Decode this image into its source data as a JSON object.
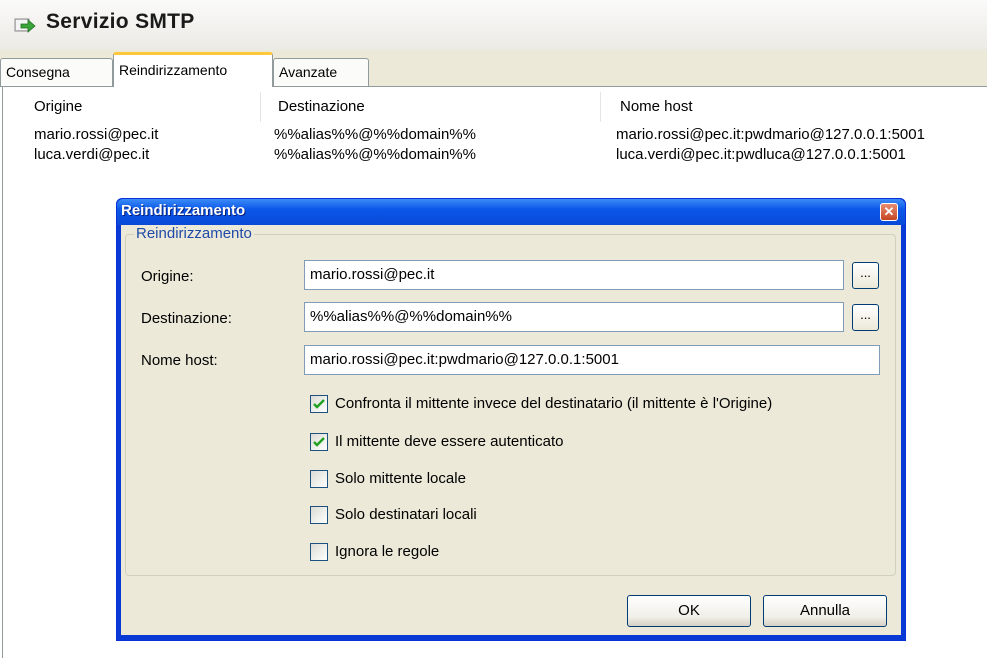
{
  "header": {
    "title": "Servizio SMTP",
    "icon": "arrow-icon"
  },
  "tabs": [
    {
      "label": "Consegna"
    },
    {
      "label": "Reindirizzamento",
      "active": true
    },
    {
      "label": "Avanzate"
    }
  ],
  "list": {
    "columns": [
      "Origine",
      "Destinazione",
      "Nome host"
    ],
    "rows": [
      {
        "origine": "mario.rossi@pec.it",
        "destinazione": "%%alias%%@%%domain%%",
        "host": "mario.rossi@pec.it:pwdmario@127.0.0.1:5001"
      },
      {
        "origine": "luca.verdi@pec.it",
        "destinazione": "%%alias%%@%%domain%%",
        "host": "luca.verdi@pec.it:pwdluca@127.0.0.1:5001"
      }
    ]
  },
  "dialog": {
    "title": "Reindirizzamento",
    "close_glyph": "✕",
    "group_label": "Reindirizzamento",
    "fields": {
      "origine_label": "Origine:",
      "origine_value": "mario.rossi@pec.it",
      "destinazione_label": "Destinazione:",
      "destinazione_value": "%%alias%%@%%domain%%",
      "host_label": "Nome host:",
      "host_value": "mario.rossi@pec.it:pwdmario@127.0.0.1:5001",
      "browse_glyph": "..."
    },
    "checkboxes": [
      {
        "label": "Confronta il mittente invece del destinatario (il mittente è l'Origine)",
        "checked": true
      },
      {
        "label": "Il mittente deve essere autenticato",
        "checked": true
      },
      {
        "label": "Solo mittente locale",
        "checked": false
      },
      {
        "label": "Solo destinatari locali",
        "checked": false
      },
      {
        "label": "Ignora le regole",
        "checked": false
      }
    ],
    "ok_label": "OK",
    "cancel_label": "Annulla"
  },
  "colors": {
    "titlebar": "#0b57e8",
    "check": "#21a121",
    "tab_highlight": "#ffc73c"
  }
}
